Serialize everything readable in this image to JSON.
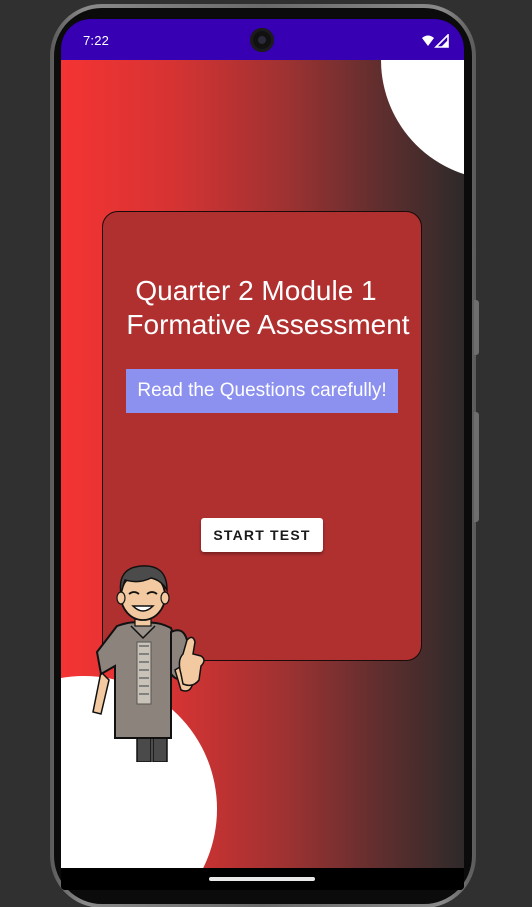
{
  "status_bar": {
    "time": "7:22",
    "background_color": "#3700b3",
    "icons": [
      "wifi-icon",
      "cellular-signal-icon"
    ]
  },
  "screen": {
    "title_line1": "Quarter 2 Module 1",
    "title_line2": "Formative Assessment",
    "instruction": "Read the Questions carefully!",
    "start_button_label": "START TEST"
  },
  "colors": {
    "gradient_start": "#f53333",
    "gradient_end": "#2e2a2a",
    "card": "#b03030",
    "instruction_bg": "#8c91f0",
    "button_bg": "#ffffff"
  },
  "illustration": "thumbs-up-boy-illustration"
}
